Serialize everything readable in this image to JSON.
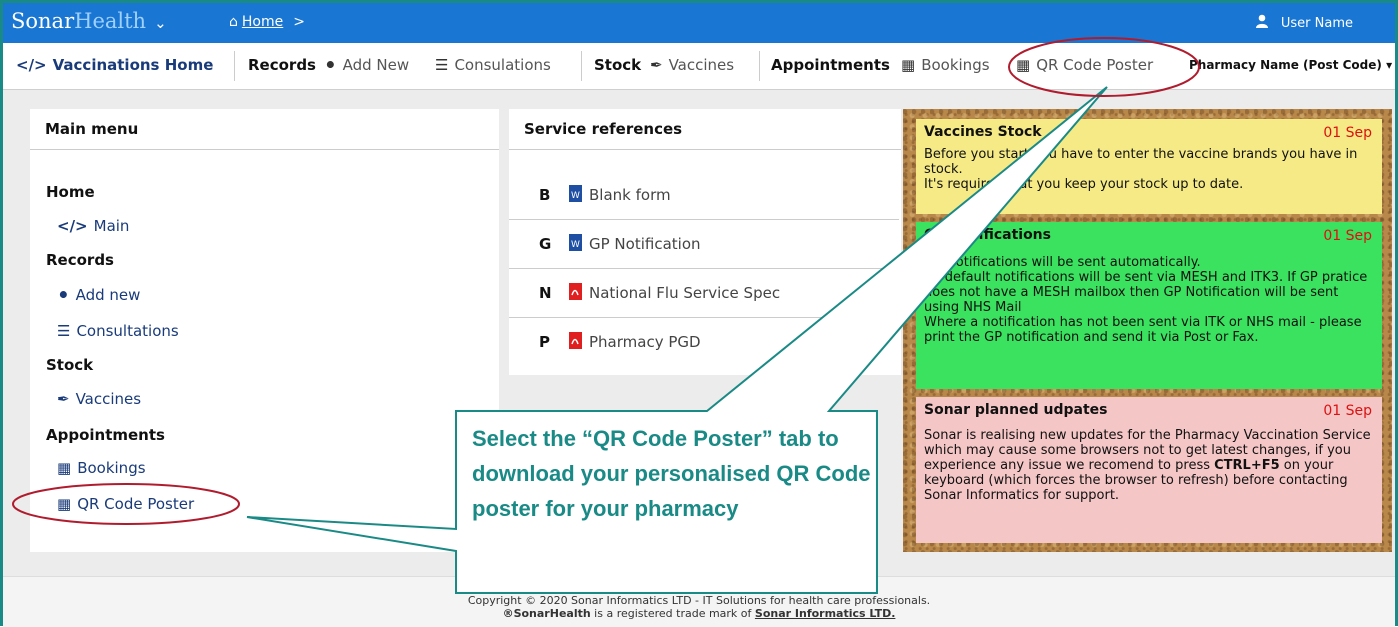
{
  "app": {
    "brand_part1": "Sonar",
    "brand_part2": "Health"
  },
  "breadcrumb": {
    "home": "Home",
    "separator": ">"
  },
  "user": {
    "name": "User Name"
  },
  "nav": {
    "vaccinations_home": "Vaccinations Home",
    "records": "Records",
    "add_new": "Add New",
    "consultations": "Consulations",
    "stock": "Stock",
    "vaccines": "Vaccines",
    "appointments": "Appointments",
    "bookings": "Bookings",
    "qr_code_poster": "QR Code Poster",
    "pharmacy": "Pharmacy Name (Post Code)"
  },
  "main_menu": {
    "title": "Main menu",
    "home": "Home",
    "main": "Main",
    "records": "Records",
    "add_new": "Add new",
    "consultations": "Consultations",
    "stock": "Stock",
    "vaccines": "Vaccines",
    "appointments": "Appointments",
    "bookings": "Bookings",
    "qr_code_poster": "QR Code Poster"
  },
  "service_references": {
    "title": "Service references",
    "items": [
      {
        "letter": "B",
        "label": "Blank form",
        "doc_type": "word"
      },
      {
        "letter": "G",
        "label": "GP Notification",
        "doc_type": "word"
      },
      {
        "letter": "N",
        "label": "National Flu Service Spec",
        "doc_type": "pdf"
      },
      {
        "letter": "P",
        "label": "Pharmacy PGD",
        "doc_type": "pdf"
      }
    ]
  },
  "notices": [
    {
      "title": "Vaccines Stock",
      "date": "01 Sep",
      "color": "#f5ea86",
      "line1": "Before you start you have to enter the vaccine brands you have in stock.",
      "line2": "It's required that you keep your stock up to date."
    },
    {
      "title": "GP Notifications",
      "date": "01 Sep",
      "color": "#3be25f",
      "line1": "GP Notifications will be sent automatically.",
      "line2": "By default notifications will be sent via MESH and ITK3. If GP pratice does not have a MESH mailbox then GP Notification will be sent using NHS Mail",
      "line3": "Where a notification has not been sent via ITK or NHS mail - please print the GP notification and send it via Post or Fax."
    },
    {
      "title": "Sonar planned udpates",
      "date": "01 Sep",
      "color": "#f5c6c6",
      "text_a": "Sonar is realising new updates for the Pharmacy Vaccination Service which may cause some browsers not to get latest changes, if you experience any issue we recomend to press ",
      "key": "CTRL+F5",
      "text_b": " on your keyboard (which forces the browser to refresh) before contacting Sonar Informatics for support."
    }
  ],
  "footer": {
    "line1": "Copyright © 2020 Sonar Informatics LTD - IT Solutions for health care professionals.",
    "brand": "®SonarHealth",
    "line2_mid": " is a registered trade mark of ",
    "company": "Sonar Informatics LTD."
  },
  "callout": {
    "text": "Select the “QR Code Poster” tab to download your personalised QR Code poster for your pharmacy",
    "color": "#1a8a86",
    "highlight_color": "#b01c2e"
  }
}
